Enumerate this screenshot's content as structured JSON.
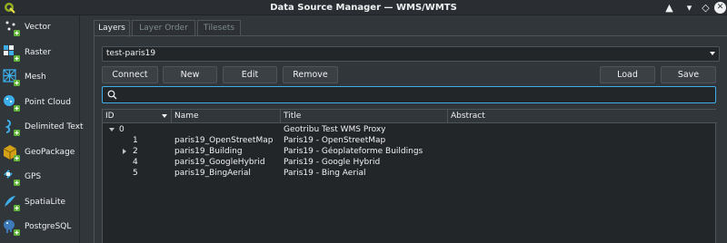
{
  "window": {
    "title": "Data Source Manager — WMS/WMTS"
  },
  "sidebar": {
    "items": [
      {
        "label": "Vector",
        "icon": "vector-icon"
      },
      {
        "label": "Raster",
        "icon": "raster-icon"
      },
      {
        "label": "Mesh",
        "icon": "mesh-icon"
      },
      {
        "label": "Point Cloud",
        "icon": "point-cloud-icon"
      },
      {
        "label": "Delimited Text",
        "icon": "delimited-text-icon"
      },
      {
        "label": "GeoPackage",
        "icon": "geopackage-icon"
      },
      {
        "label": "GPS",
        "icon": "gps-icon"
      },
      {
        "label": "SpatiaLite",
        "icon": "spatialite-icon"
      },
      {
        "label": "PostgreSQL",
        "icon": "postgresql-icon"
      }
    ]
  },
  "tabs": [
    {
      "label": "Layers",
      "active": true
    },
    {
      "label": "Layer Order",
      "active": false
    },
    {
      "label": "Tilesets",
      "active": false
    }
  ],
  "connection": {
    "selected": "test-paris19"
  },
  "buttons": {
    "connect": "Connect",
    "new": "New",
    "edit": "Edit",
    "remove": "Remove",
    "load": "Load",
    "save": "Save"
  },
  "search": {
    "value": ""
  },
  "table": {
    "headers": [
      "ID",
      "Name",
      "Title",
      "Abstract"
    ],
    "rows": [
      {
        "id": "0",
        "name": "",
        "title": "Geotribu Test WMS Proxy",
        "abstract": "",
        "expander": "open"
      },
      {
        "id": "1",
        "name": "paris19_OpenStreetMap",
        "title": "Paris19 - OpenStreetMap",
        "abstract": "",
        "expander": ""
      },
      {
        "id": "2",
        "name": "paris19_Building",
        "title": "Paris19 - Géoplateforme Buildings",
        "abstract": "",
        "expander": "closed"
      },
      {
        "id": "4",
        "name": "paris19_GoogleHybrid",
        "title": "Paris19 - Google Hybrid",
        "abstract": "",
        "expander": ""
      },
      {
        "id": "5",
        "name": "paris19_BingAerial",
        "title": "Paris19 - Bing Aerial",
        "abstract": "",
        "expander": ""
      }
    ]
  },
  "colors": {
    "accent": "#3daee9",
    "background": "#31363b",
    "plus": "#5fb336"
  }
}
